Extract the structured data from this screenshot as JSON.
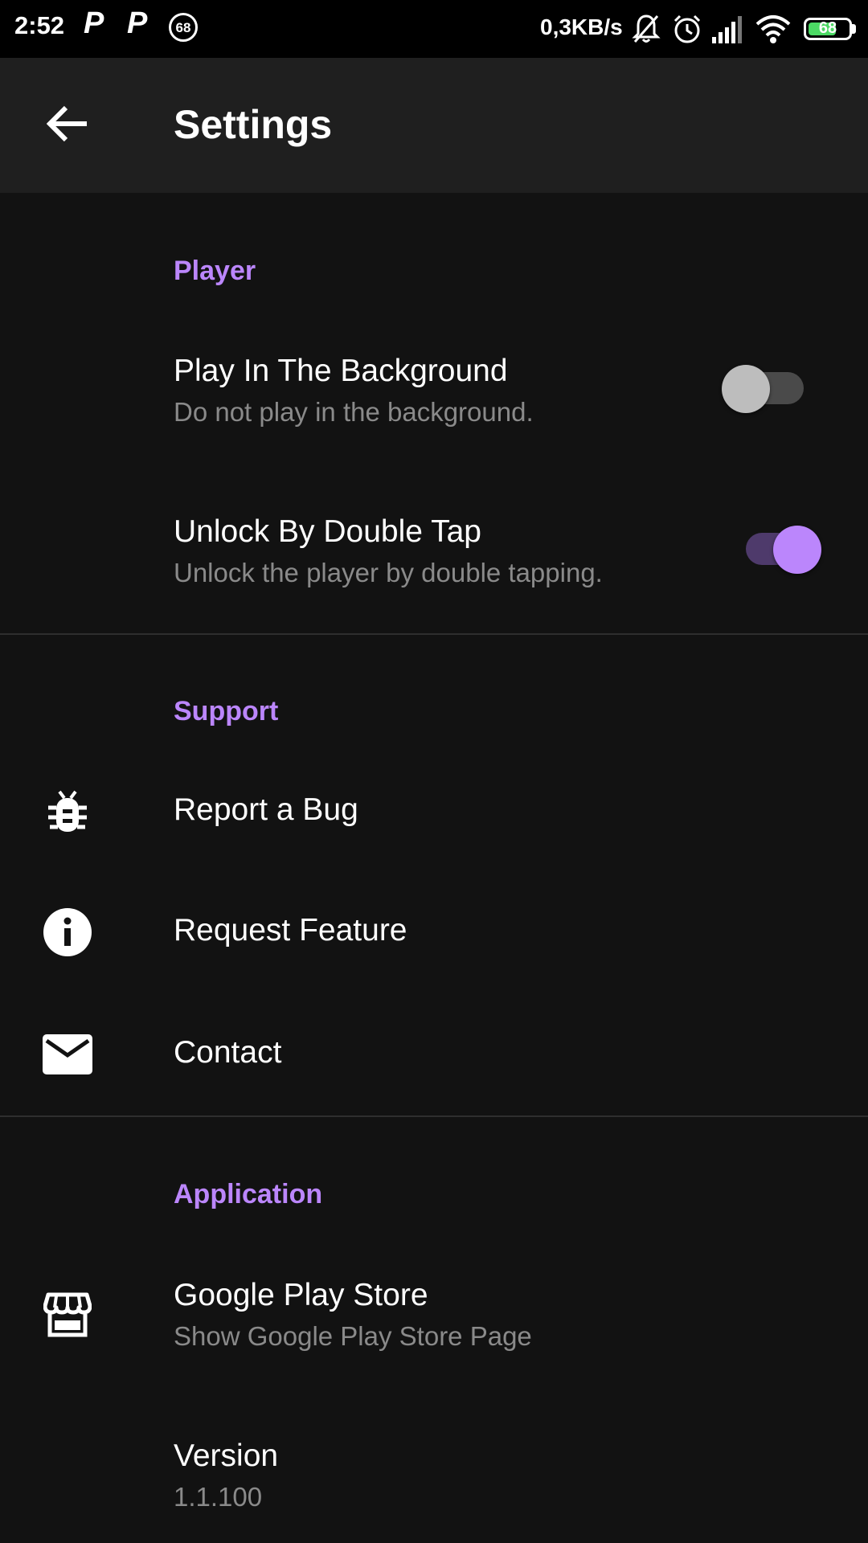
{
  "status_bar": {
    "time": "2:52",
    "notif_app_1": "P",
    "notif_app_2": "P",
    "notif_badge": "68",
    "net_speed": "0,3KB/s",
    "battery": "68",
    "icons": [
      "mute-bell-icon",
      "alarm-icon",
      "signal-icon",
      "wifi-icon",
      "battery-icon"
    ]
  },
  "app_bar": {
    "title": "Settings",
    "back_icon": "arrow-back-icon"
  },
  "colors": {
    "accent": "#bb86fc",
    "background": "#121212",
    "app_bar": "#1f1f1f",
    "summary_text": "#8a8a8a"
  },
  "sections": {
    "player": {
      "header": "Player",
      "items": [
        {
          "title": "Play In The Background",
          "summary": "Do not play in the background.",
          "checked": false
        },
        {
          "title": "Unlock By Double Tap",
          "summary": "Unlock the player by double tapping.",
          "checked": true
        }
      ]
    },
    "support": {
      "header": "Support",
      "items": [
        {
          "title": "Report a Bug",
          "icon": "bug-icon"
        },
        {
          "title": "Request Feature",
          "icon": "info-icon"
        },
        {
          "title": "Contact",
          "icon": "mail-icon"
        }
      ]
    },
    "application": {
      "header": "Application",
      "items": [
        {
          "title": "Google Play Store",
          "summary": "Show Google Play Store Page",
          "icon": "store-icon"
        },
        {
          "title": "Version",
          "summary": "1.1.100"
        }
      ]
    }
  }
}
